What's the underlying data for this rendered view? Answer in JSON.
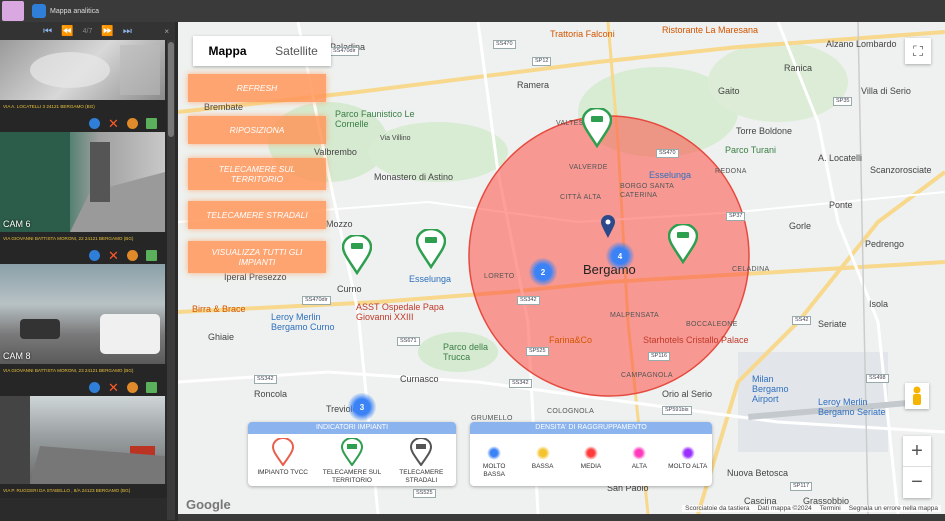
{
  "app": {
    "title": "Mappa analitica"
  },
  "player": {
    "first": "⏮",
    "prev": "⏪",
    "counter": "4/7",
    "next": "⏩",
    "last": "⏭",
    "close": "×"
  },
  "cameras": [
    {
      "address": "VIA A. LOCATELLI 3 24121 BERGAMO (BG)",
      "label": ""
    },
    {
      "address": "VIA GIOVANNI BATTISTA MORONI, 22 24121 BERGAMO (BG)",
      "label": "CAM 6"
    },
    {
      "address": "VIA GIOVANNI BATTISTA MORONI, 23 24121 BERGAMO (BG)",
      "label": "CAM 8"
    },
    {
      "address": "VIA P. RUGGERI DA STABELLO , 8/A 24123 BERGAMO (BG)",
      "label": ""
    }
  ],
  "map": {
    "type_map": "Mappa",
    "type_satellite": "Satellite",
    "fullscreen": "⛶",
    "zoom_in": "+",
    "zoom_out": "−",
    "attribution": {
      "shortcuts": "Scorciatoie da tastiera",
      "data": "Dati mappa ©2024",
      "terms": "Termini",
      "report": "Segnala un errore nella mappa"
    },
    "google": "Google"
  },
  "buttons": {
    "refresh": "REFRESH",
    "reposition": "RIPOSIZIONA",
    "territory": "TELECAMERE SUL TERRITORIO",
    "street": "TELECAMERE STRADALI",
    "all": "VISUALIZZA TUTTI GLI IMPIANTI"
  },
  "places": {
    "city": "Bergamo",
    "alzano": "Alzano Lombardo",
    "ranica": "Ranica",
    "gaito": "Gaito",
    "villa_serio": "Villa di Serio",
    "ramera": "Ramera",
    "paladina": "Paladina",
    "brembate": "Brembate",
    "valbrembo": "Valbrembo",
    "mozzo": "Mozzo",
    "curno": "Curno",
    "ghiaie": "Ghiaie",
    "roncola": "Roncola",
    "curnasco": "Curnasco",
    "treviolo": "Treviolo",
    "torre_boldone": "Torre Boldone",
    "locatelli": "A. Locatelli",
    "scanzo": "Scanzorosciate",
    "ponte": "Ponte",
    "gorle": "Gorle",
    "pedrengo": "Pedrengo",
    "isola": "Isola",
    "seriate": "Seriate",
    "orio": "Orio al Serio",
    "azzano": "Azzano",
    "san_paolo": "San Paolo",
    "nuova_betosca": "Nuova Betosca",
    "cascina": "Cascina",
    "grassobbio": "Grassobbio",
    "valtesse": "VALTESSE",
    "valverde": "VALVERDE",
    "citta_alta": "CITTÀ ALTA",
    "borgo": "BORGO SANTA CATERINA",
    "redona": "REDONA",
    "celadina": "CELADINA",
    "loreto": "LORETO",
    "malpensata": "MALPENSATA",
    "boccaleone": "BOCCALEONE",
    "campagnola": "CAMPAGNOLA",
    "colognola": "COLOGNOLA",
    "grumello": "GRUMELLO",
    "del_piano": "DEL PIANO",
    "longuelo": "LONGUELO",
    "parco_faunistico": "Parco Faunistico Le Cornelle",
    "villa_vilino": "Via Villino",
    "astino": "Monastero di Astino",
    "parco_turani": "Parco Turani",
    "esselunga1": "Esselunga",
    "esselunga2": "Esselunga",
    "asst": "ASST Ospedale Papa Giovanni XXIII",
    "parco_trucca": "Parco della Trucca",
    "leroy_curno": "Leroy Merlin Bergamo Curno",
    "leroy_seriate": "Leroy Merlin Bergamo Seriate",
    "birra": "Birra & Brace",
    "iperal": "Iperal Presezzo",
    "trattoria": "Trattoria Falconi",
    "ristorante": "Ristorante La Maresana",
    "farina": "Farina&Co",
    "starhotels": "Starhotels Cristallo Palace",
    "aeroporto": "Milan Bergamo Airport",
    "via_levata": "Via Levata"
  },
  "roads": [
    "SS470dir",
    "SS470",
    "SP12",
    "SS470",
    "SS671",
    "SP35",
    "SP36",
    "SP37",
    "SS342",
    "SS42",
    "SS470dir",
    "SS342",
    "SS671",
    "SS342",
    "SP525",
    "SS671",
    "SP116",
    "SS525",
    "SP591bis",
    "SP117",
    "SS498",
    "SS42",
    "SP42"
  ],
  "clusters": [
    {
      "count": "2"
    },
    {
      "count": "4"
    },
    {
      "count": "3"
    }
  ],
  "legend_left": {
    "title": "INDICATORI IMPIANTI",
    "items": [
      "IMPIANTO TVCC",
      "TELECAMERE SUL TERRITORIO",
      "TELECAMERE STRADALI"
    ]
  },
  "legend_right": {
    "title": "DENSITA' DI RAGGRUPPAMENTO",
    "items": [
      "MOLTO BASSA",
      "BASSA",
      "MEDIA",
      "ALTA",
      "MOLTO ALTA"
    ],
    "colors": [
      "#3b82f6",
      "#f4c430",
      "#ff3b3b",
      "#ff3bbd",
      "#9b30ff"
    ]
  }
}
